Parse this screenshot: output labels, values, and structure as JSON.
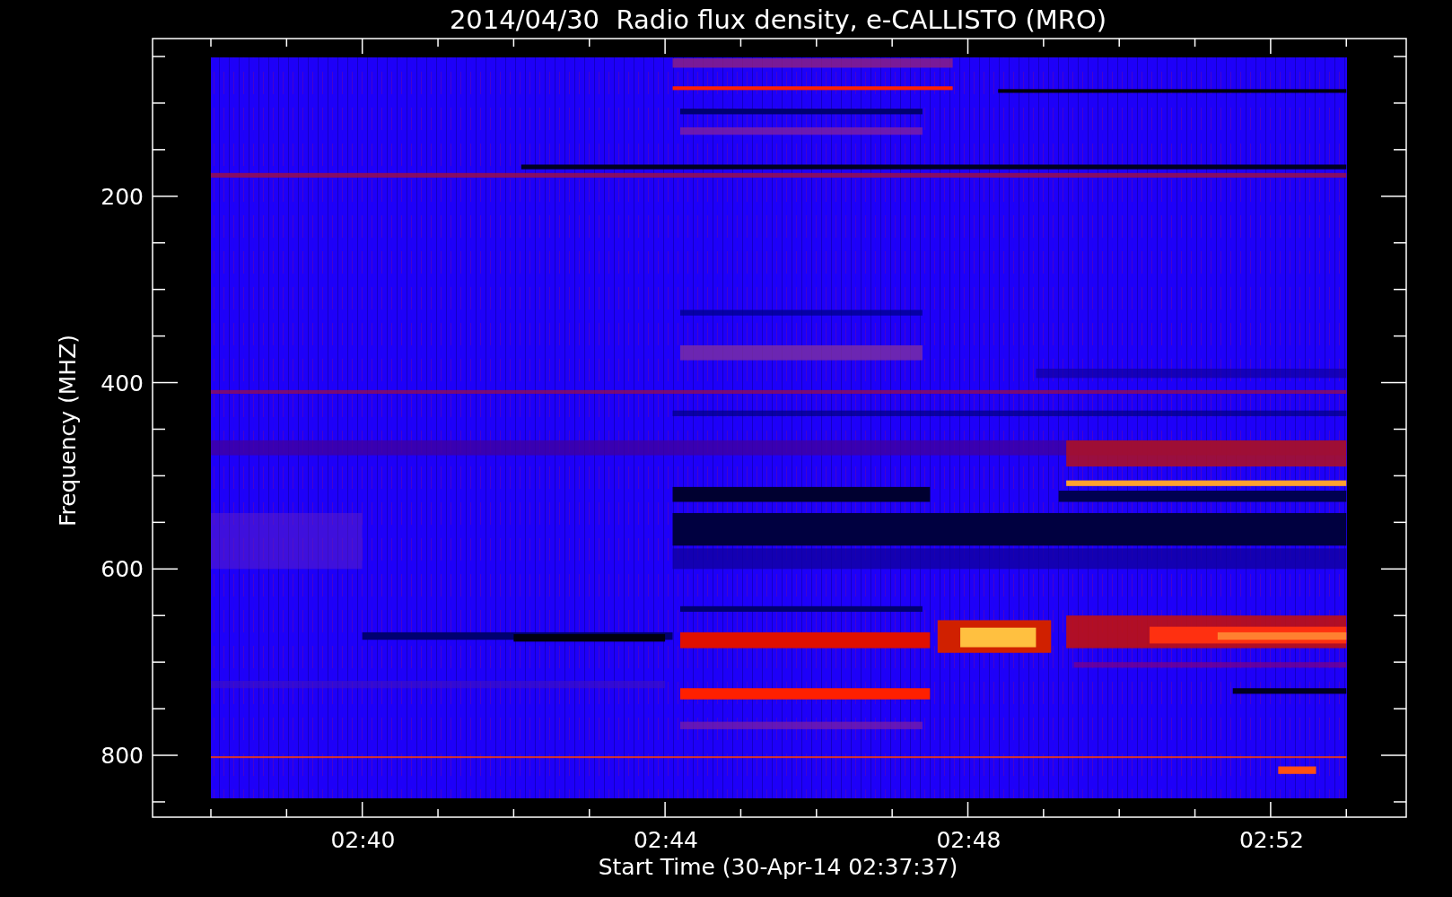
{
  "plot": {
    "title": "2014/04/30  Radio flux density, e-CALLISTO (MRO)",
    "xlabel": "Start Time (30-Apr-14 02:37:37)",
    "ylabel": "Frequency (MHZ)",
    "xtick_labels": [
      "02:40",
      "02:44",
      "02:48",
      "02:52"
    ],
    "ytick_labels": [
      "200",
      "400",
      "600",
      "800"
    ]
  }
}
